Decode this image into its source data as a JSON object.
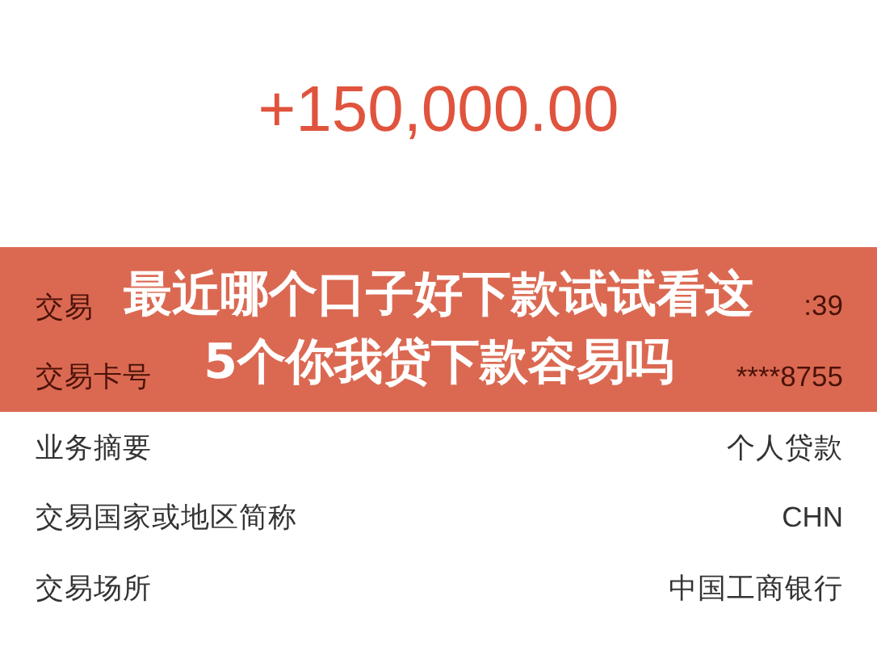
{
  "amount": "+150,000.00",
  "details": [
    {
      "label": "交易",
      "value": ":39"
    },
    {
      "label": "交易卡号",
      "value": "****8755"
    },
    {
      "label": "业务摘要",
      "value": "个人贷款"
    },
    {
      "label": "交易国家或地区简称",
      "value": "CHN"
    },
    {
      "label": "交易场所",
      "value": "中国工商银行"
    }
  ],
  "banner": {
    "lines": [
      "最近哪个口子好下款试试看这",
      "5个你我贷下款容易吗"
    ]
  }
}
